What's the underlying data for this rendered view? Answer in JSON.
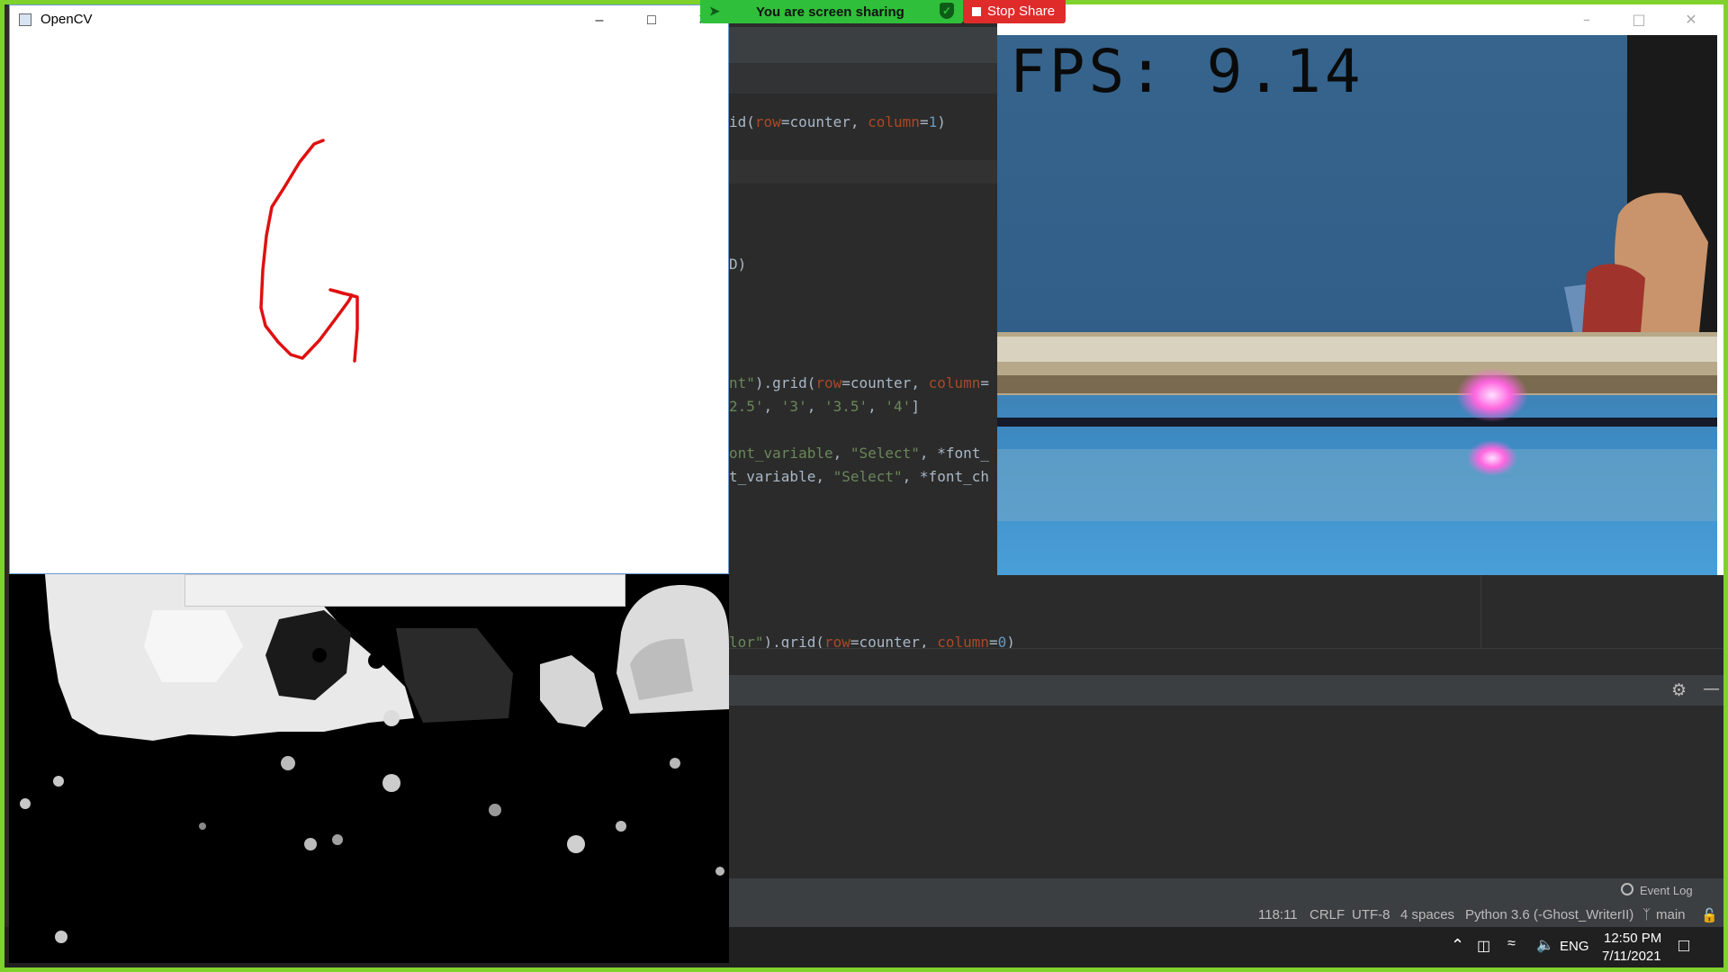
{
  "share": {
    "label": "You are screen sharing",
    "stop_label": "Stop Share",
    "border_color": "#7fd22c",
    "pill_color": "#2fbf3a",
    "stop_color": "#e02b2b"
  },
  "canvas_window": {
    "title": "OpenCV",
    "icon": "opencv-window-icon",
    "stroke_color": "#e01010"
  },
  "camera_window": {
    "fps_text": "FPS: 9.14"
  },
  "editor": {
    "lines": [
      "id(row=counter, column=1)",
      "D)",
      "nt\").grid(row=counter, column=",
      "2.5', '3', '3.5', '4']",
      "ont_variable, \"Select\", *font_",
      "t_variable, \"Select\", *font_ch",
      "lor\").grid(row=counter, column=0)"
    ]
  },
  "status_bar": {
    "position": "118:11",
    "line_ending": "CRLF",
    "encoding": "UTF-8",
    "indent": "4 spaces",
    "interpreter": "Python 3.6 (-Ghost_WriterII)",
    "branch": "main",
    "event_log": "Event Log"
  },
  "taskbar": {
    "language": "ENG",
    "time": "12:50 PM",
    "date": "7/11/2021"
  }
}
